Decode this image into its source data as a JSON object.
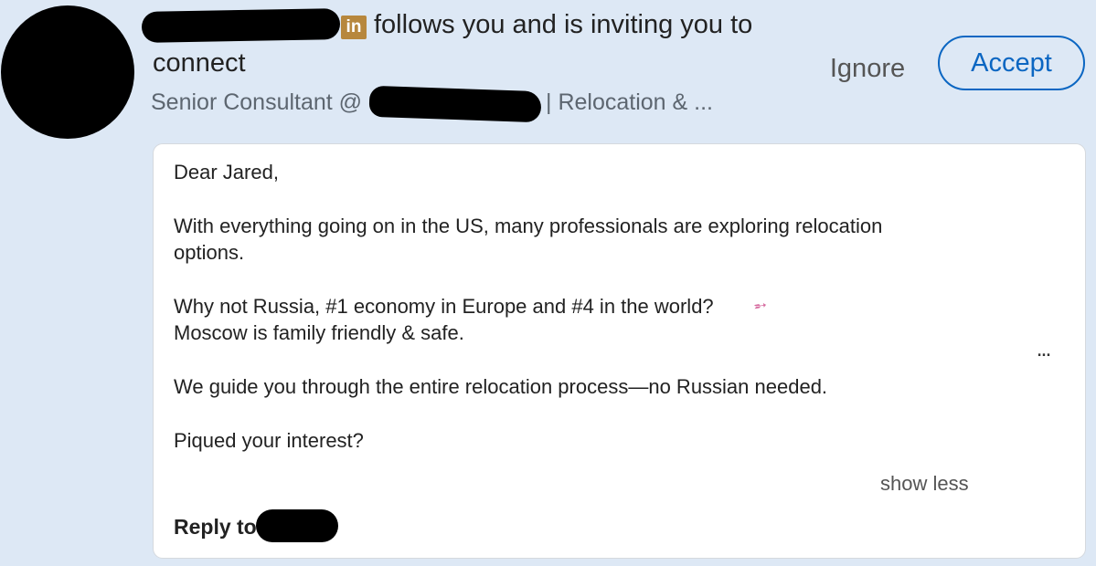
{
  "notification": {
    "headline_part1": "follows you and is inviting you to",
    "headline_part2": "connect",
    "subtitle_left": "Senior Consultant @",
    "subtitle_right": "| Relocation & ...",
    "icons": {
      "linkedin": "linkedin-icon",
      "rocket": "rocket-icon",
      "more": "more-icon"
    },
    "linkedin_glyph": "in",
    "ignore_label": "Ignore",
    "accept_label": "Accept",
    "accent_color": "#0b66c2",
    "background_color": "#dde8f5"
  },
  "message": {
    "lines": [
      "Dear Jared,",
      "With everything going on in the US, many professionals are exploring relocation",
      "options.",
      "Why not Russia, #1 economy in Europe and #4 in the world?",
      "Moscow is family friendly & safe.",
      "We guide you through the entire relocation process—no Russian needed.",
      "Piqued your interest?"
    ],
    "more_label": "...",
    "show_less_label": "show less",
    "reply_label": "Reply to"
  }
}
